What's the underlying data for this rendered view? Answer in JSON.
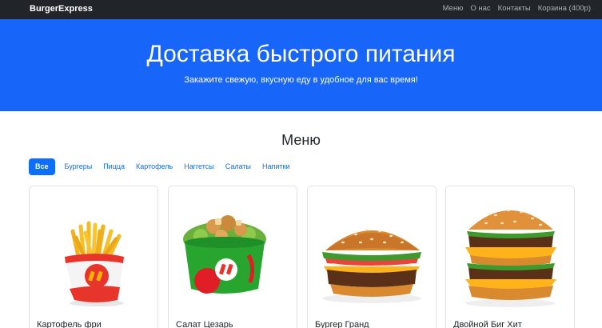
{
  "brand": "BurgerExpress",
  "nav": [
    {
      "label": "Меню"
    },
    {
      "label": "О нас"
    },
    {
      "label": "Контакты"
    },
    {
      "label": "Корзина (400р)"
    }
  ],
  "hero": {
    "title": "Доставка быстрого питания",
    "subtitle": "Закажите свежую, вкусную еду в удобное для вас время!"
  },
  "menu": {
    "title": "Меню",
    "filters": [
      {
        "label": "Все",
        "active": true
      },
      {
        "label": "Бургеры"
      },
      {
        "label": "Пицца"
      },
      {
        "label": "Картофель"
      },
      {
        "label": "Наггетсы"
      },
      {
        "label": "Салаты"
      },
      {
        "label": "Напитки"
      }
    ],
    "products": [
      {
        "title": "Картофель фри",
        "image": "fries-image"
      },
      {
        "title": "Салат Цезарь",
        "image": "caesar-salad-image"
      },
      {
        "title": "Бургер Гранд",
        "image": "grand-burger-image"
      },
      {
        "title": "Двойной Биг Хит",
        "image": "double-big-hit-image"
      }
    ]
  },
  "colors": {
    "navbar": "#212529",
    "hero": "#1865fa",
    "accent": "#0d6efd",
    "logo_red": "#e8352b",
    "logo_yellow": "#ffb400"
  }
}
